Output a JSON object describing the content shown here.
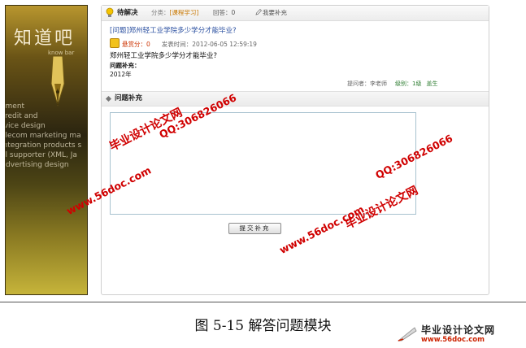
{
  "banner": {
    "logo_cn": "知道吧",
    "logo_en": "know bar",
    "bg_lines": [
      "ement",
      "credit and",
      "rvice design",
      "elecom marketing ma",
      "integration products s",
      "",
      "al supporter (XML, Ja",
      "Advertising design"
    ]
  },
  "question": {
    "status": "待解决",
    "category_label": "分类：",
    "category_value": "[课程学习]",
    "answers": "回答：0",
    "supplement_link": "我要补充",
    "title": "[问题]郑州轻工业学院多少学分才能毕业?",
    "reward": "悬赏分：0",
    "time": "发表时间：2012-06-05 12:59:19",
    "body": "郑州轻工业学院多少学分才能毕业?",
    "supplement_label": "问题补充：",
    "supplement_value": "2012年",
    "asker": "提问者：李老师",
    "level": "级别：1级",
    "follow": "盖生"
  },
  "section": {
    "title": "问题补充"
  },
  "form": {
    "textarea_value": "",
    "submit_label": "提交补充"
  },
  "watermarks": {
    "wm1": "毕业设计论文网",
    "wm2": "www.56doc.com",
    "wm3": "QQ:306826066",
    "wm4": "www.56doc.com",
    "wm5": "QQ:306826066",
    "wm6": "毕业设计论文网"
  },
  "caption": "图 5-15 解答问题模块",
  "brand": {
    "name": "毕业设计论文网",
    "url": "www.56doc.com"
  },
  "colors": {
    "link": "#2a4fa0",
    "reward": "#cc3300",
    "category": "#c87700",
    "watermark": "#d00000"
  }
}
